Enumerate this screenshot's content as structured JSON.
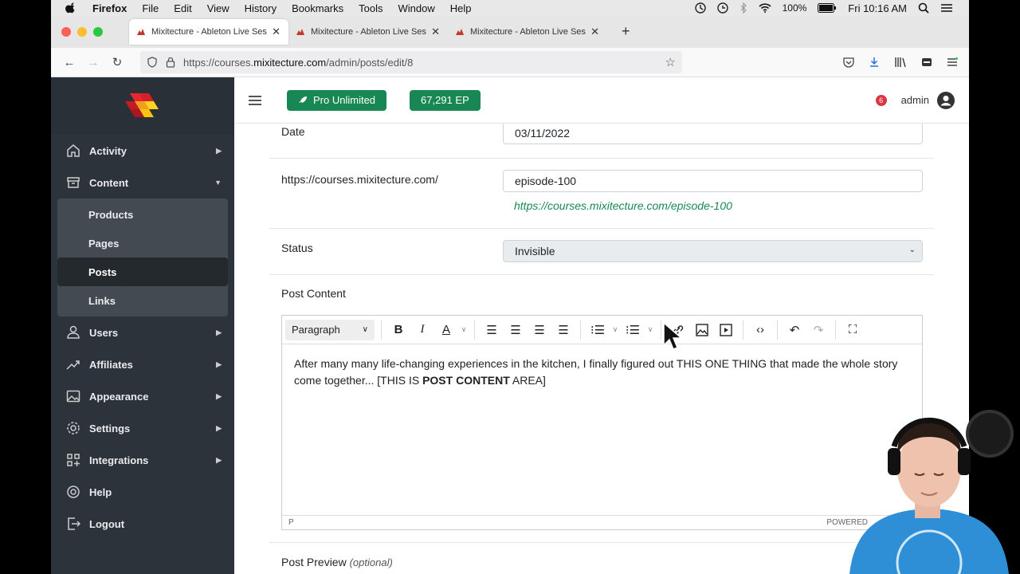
{
  "menubar": {
    "app": "Firefox",
    "items": [
      "File",
      "Edit",
      "View",
      "History",
      "Bookmarks",
      "Tools",
      "Window",
      "Help"
    ],
    "battery": "100%",
    "clock": "Fri 10:16 AM"
  },
  "tabs": [
    {
      "title": "Mixitecture - Ableton Live Sessi"
    },
    {
      "title": "Mixitecture - Ableton Live Sessi"
    },
    {
      "title": "Mixitecture - Ableton Live Sessi"
    }
  ],
  "url": {
    "prefix": "https://courses.",
    "host": "mixitecture.com",
    "path": "/admin/posts/edit/8"
  },
  "topbar": {
    "pro_label": "Pro Unlimited",
    "ep_label": "67,291 EP",
    "notif_count": "6",
    "user": "admin"
  },
  "sidebar": {
    "items": [
      {
        "label": "Activity",
        "icon": "home-icon"
      },
      {
        "label": "Content",
        "icon": "archive-icon"
      },
      {
        "label": "Users",
        "icon": "users-icon"
      },
      {
        "label": "Affiliates",
        "icon": "trend-icon"
      },
      {
        "label": "Appearance",
        "icon": "image-icon"
      },
      {
        "label": "Settings",
        "icon": "gear-icon"
      },
      {
        "label": "Integrations",
        "icon": "grid-plus-icon"
      },
      {
        "label": "Help",
        "icon": "lifebuoy-icon"
      },
      {
        "label": "Logout",
        "icon": "logout-icon"
      }
    ],
    "content_sub": [
      "Products",
      "Pages",
      "Posts",
      "Links"
    ]
  },
  "form": {
    "date_label": "Date",
    "date_value": "03/11/2022",
    "slug_label": "https://courses.mixitecture.com/",
    "slug_value": "episode-100",
    "slug_preview": "https://courses.mixitecture.com/episode-100",
    "status_label": "Status",
    "status_value": "Invisible",
    "content_label": "Post Content",
    "preview_label": "Post Preview",
    "preview_optional": "(optional)"
  },
  "editor": {
    "block_format": "Paragraph",
    "body_before": "After many many life-changing experiences in the kitchen, I finally figured out THIS ONE THING that made the whole story come together... [THIS IS ",
    "body_bold": "POST CONTENT",
    "body_after": " AREA]",
    "path": "P",
    "powered": "POWERED"
  },
  "colors": {
    "accent_green": "#198754",
    "sidebar_bg": "#2d333a"
  }
}
